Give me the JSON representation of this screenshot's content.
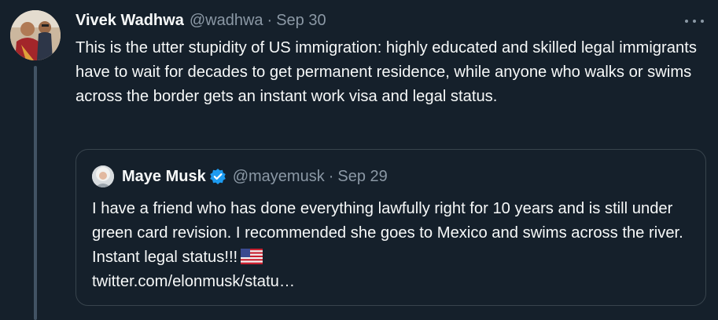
{
  "tweet": {
    "display_name": "Vivek Wadhwa",
    "handle": "@wadhwa",
    "separator": "·",
    "date": "Sep 30",
    "text": "This is the utter stupidity of US immigration: highly educated and skilled legal immigrants have to wait for decades to get permanent residence, while anyone who walks or swims across the border gets an instant work visa and legal status.",
    "more_icon": "more-horizontal-icon"
  },
  "quoted_tweet": {
    "display_name": "Maye Musk",
    "verified_icon": "verified-badge-icon",
    "handle": "@mayemusk",
    "separator": "·",
    "date": "Sep 29",
    "text_main": "I have a friend who has done everything lawfully right for 10 years and is still under green card revision. I recommended she goes to Mexico and swims across the river. Instant legal status!!!",
    "flag_icon": "us-flag-emoji",
    "link": "twitter.com/elonmusk/statu…"
  },
  "colors": {
    "background": "#15202b",
    "text": "#f7f9f9",
    "secondary_text": "#8b98a5",
    "border": "#38444d",
    "verified": "#1d9bf0"
  }
}
